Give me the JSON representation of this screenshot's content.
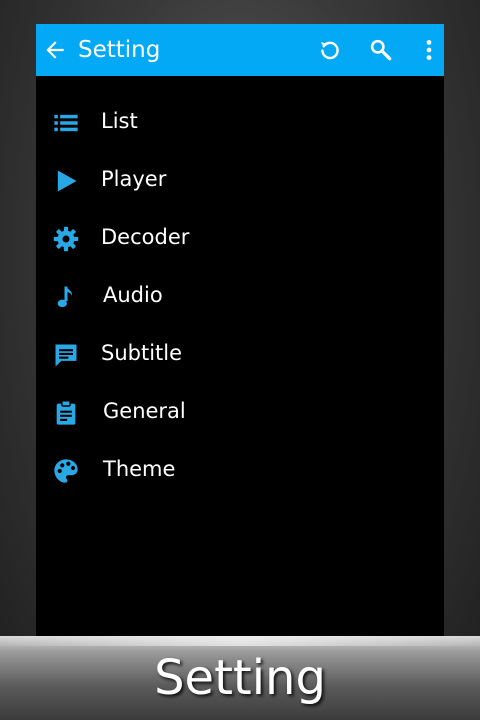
{
  "appbar": {
    "title": "Setting",
    "color": "#03a9f4",
    "back_icon": "arrow-left-icon",
    "actions": [
      {
        "icon": "refresh-icon"
      },
      {
        "icon": "search-icon"
      },
      {
        "icon": "more-vert-icon"
      }
    ]
  },
  "menu": {
    "icon_color": "#29a8e6",
    "items": [
      {
        "label": "List",
        "icon": "list-icon"
      },
      {
        "label": "Player",
        "icon": "play-icon"
      },
      {
        "label": "Decoder",
        "icon": "gear-icon"
      },
      {
        "label": "Audio",
        "icon": "music-note-icon"
      },
      {
        "label": "Subtitle",
        "icon": "chat-bubble-icon"
      },
      {
        "label": "General",
        "icon": "clipboard-icon"
      },
      {
        "label": "Theme",
        "icon": "palette-icon"
      }
    ]
  },
  "caption": {
    "text": "Setting"
  }
}
